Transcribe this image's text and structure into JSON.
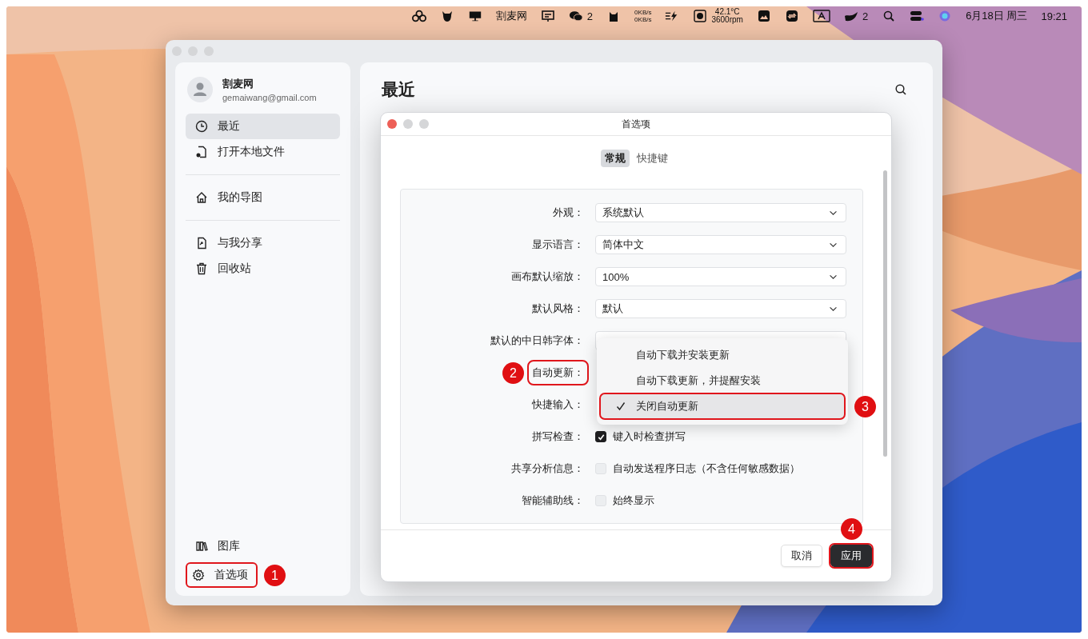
{
  "menu_bar": {
    "app_name": "割麦网",
    "chat_count": "2",
    "net_up": "0KB/s",
    "net_down": "0KB/s",
    "temperature": "42.1°C",
    "fan_speed": "3600rpm",
    "tray_count": "2",
    "date": "6月18日 周三",
    "time": "19:21"
  },
  "sidebar": {
    "user": {
      "name": "割麦网",
      "email": "gemaiwang@gmail.com"
    },
    "groups": [
      [
        {
          "label": "最近",
          "kind": "clock",
          "selected": true
        },
        {
          "label": "打开本地文件",
          "kind": "file",
          "selected": false
        }
      ],
      [
        {
          "label": "我的导图",
          "kind": "home",
          "selected": false
        }
      ],
      [
        {
          "label": "与我分享",
          "kind": "share",
          "selected": false
        },
        {
          "label": "回收站",
          "kind": "trash",
          "selected": false
        }
      ]
    ],
    "bottom": [
      {
        "label": "图库",
        "kind": "library",
        "selected": false
      },
      {
        "label": "首选项",
        "kind": "gear",
        "selected": false,
        "step": "1"
      }
    ]
  },
  "main": {
    "title": "最近"
  },
  "dialog": {
    "title": "首选项",
    "tabs": [
      {
        "label": "常规",
        "selected": true
      },
      {
        "label": "快捷键",
        "selected": false
      }
    ],
    "settings": [
      {
        "label": "外观：",
        "kind": "select",
        "value": "系统默认"
      },
      {
        "label": "显示语言：",
        "kind": "select",
        "value": "简体中文"
      },
      {
        "label": "画布默认缩放：",
        "kind": "select",
        "value": "100%"
      },
      {
        "label": "默认风格：",
        "kind": "select",
        "value": "默认"
      },
      {
        "label": "默认的中日韩字体：",
        "kind": "select"
      },
      {
        "label": "自动更新：",
        "kind": "covered",
        "step": "2"
      },
      {
        "label": "快捷输入：",
        "kind": "covered"
      },
      {
        "label": "拼写检查：",
        "kind": "checkbox",
        "checked": true,
        "text": "键入时检查拼写"
      },
      {
        "label": "共享分析信息：",
        "kind": "checkbox",
        "checked": false,
        "text": "自动发送程序日志（不含任何敏感数据）"
      },
      {
        "label": "智能辅助线：",
        "kind": "checkbox",
        "checked": false,
        "text": "始终显示"
      }
    ],
    "menu": [
      {
        "label": "自动下载并安装更新",
        "selected": false
      },
      {
        "label": "自动下载更新，并提醒安装",
        "selected": false
      },
      {
        "label": "关闭自动更新",
        "selected": true,
        "step": "3"
      }
    ],
    "buttons": [
      {
        "label": "取消",
        "kind": "secondary"
      },
      {
        "label": "应用",
        "kind": "primary",
        "step": "4"
      }
    ]
  }
}
